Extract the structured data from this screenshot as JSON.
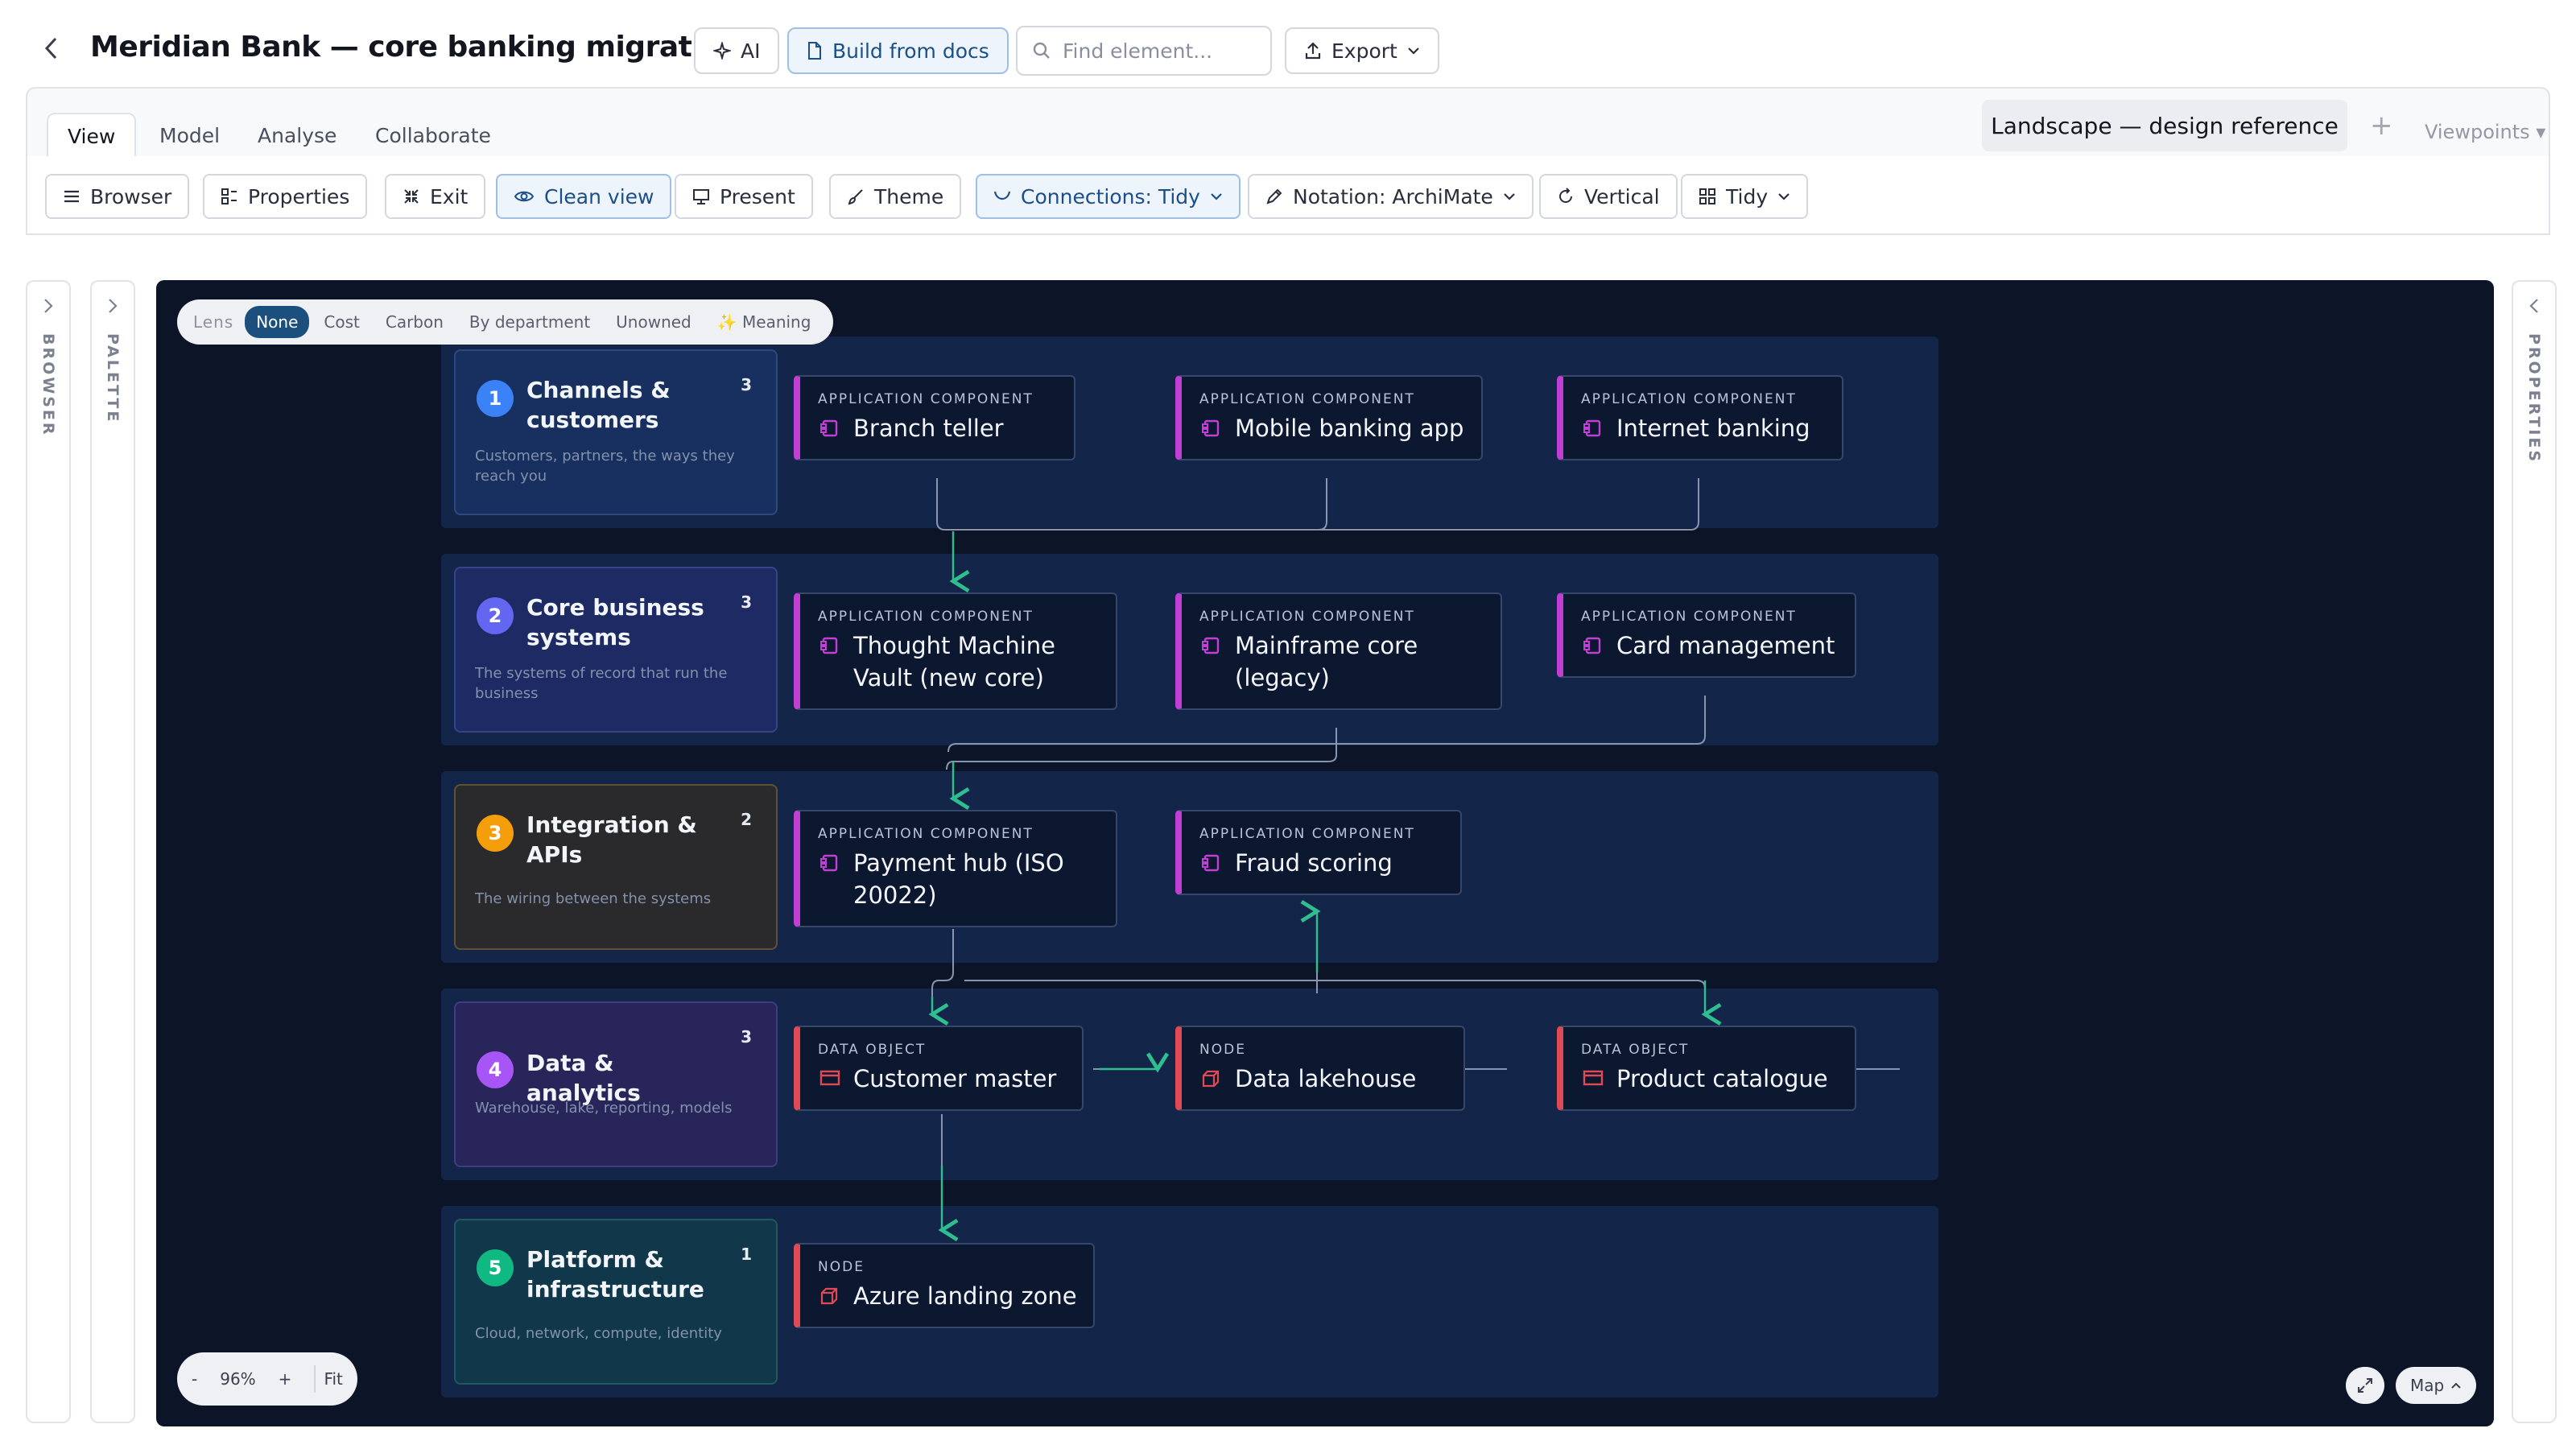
{
  "header": {
    "title": "Meridian Bank — core banking migration",
    "ai_label": "AI",
    "build_label": "Build from docs",
    "search_placeholder": "Find element...",
    "export_label": "Export"
  },
  "menu": {
    "tabs": [
      {
        "label": "View"
      },
      {
        "label": "Model"
      },
      {
        "label": "Analyse"
      },
      {
        "label": "Collaborate"
      }
    ],
    "active_view": "Landscape — design reference",
    "viewpoints_label": "Viewpoints"
  },
  "toolbar": {
    "browser": "Browser",
    "properties": "Properties",
    "exit": "Exit",
    "clean_view": "Clean view",
    "present": "Present",
    "theme": "Theme",
    "connections": "Connections: Tidy",
    "notation": "Notation: ArchiMate",
    "vertical": "Vertical",
    "tidy": "Tidy"
  },
  "side": {
    "browser": "BROWSER",
    "palette": "PALETTE",
    "properties": "PROPERTIES"
  },
  "lens": {
    "label": "Lens",
    "options": [
      "None",
      "Cost",
      "Carbon",
      "By department",
      "Unowned",
      "✨ Meaning"
    ],
    "selected": "None"
  },
  "groups": [
    {
      "num": "1",
      "title": "Channels & customers",
      "count": "3",
      "desc": "Customers, partners, the ways they reach you",
      "color": "#3b82f6"
    },
    {
      "num": "2",
      "title": "Core business systems",
      "count": "3",
      "desc": "The systems of record that run the business",
      "color": "#6366f1"
    },
    {
      "num": "3",
      "title": "Integration & APIs",
      "count": "2",
      "desc": "The wiring between the systems",
      "color": "#f59e0b"
    },
    {
      "num": "4",
      "title": "Data & analytics",
      "count": "3",
      "desc": "Warehouse, lake, reporting, models",
      "color": "#a855f7"
    },
    {
      "num": "5",
      "title": "Platform & infrastructure",
      "count": "1",
      "desc": "Cloud, network, compute, identity",
      "color": "#10b981"
    }
  ],
  "elements": {
    "branch_teller": {
      "type": "APPLICATION COMPONENT",
      "name": "Branch teller"
    },
    "mobile_banking": {
      "type": "APPLICATION COMPONENT",
      "name": "Mobile banking app"
    },
    "internet_banking": {
      "type": "APPLICATION COMPONENT",
      "name": "Internet banking"
    },
    "tm_vault": {
      "type": "APPLICATION COMPONENT",
      "name1": "Thought Machine",
      "name2": "Vault (new core)"
    },
    "mainframe": {
      "type": "APPLICATION COMPONENT",
      "name1": "Mainframe core",
      "name2": "(legacy)"
    },
    "card_mgmt": {
      "type": "APPLICATION COMPONENT",
      "name": "Card management"
    },
    "payment_hub": {
      "type": "APPLICATION COMPONENT",
      "name1": "Payment hub (ISO",
      "name2": "20022)"
    },
    "fraud": {
      "type": "APPLICATION COMPONENT",
      "name": "Fraud scoring"
    },
    "customer_master": {
      "type": "DATA OBJECT",
      "name": "Customer master"
    },
    "lakehouse": {
      "type": "NODE",
      "name": "Data lakehouse"
    },
    "product_catalogue": {
      "type": "DATA OBJECT",
      "name": "Product catalogue"
    },
    "azure": {
      "type": "NODE",
      "name": "Azure landing zone"
    }
  },
  "zoom": {
    "minus": "-",
    "level": "96%",
    "plus": "+",
    "fit": "Fit"
  },
  "map_label": "Map",
  "colors": {
    "canvas": "#0b1527",
    "band": "#13264a",
    "app_component": "#c13fd4",
    "data_object": "#e04a55",
    "connector": "#2fbf8f",
    "accent": "#1b4f8a"
  }
}
